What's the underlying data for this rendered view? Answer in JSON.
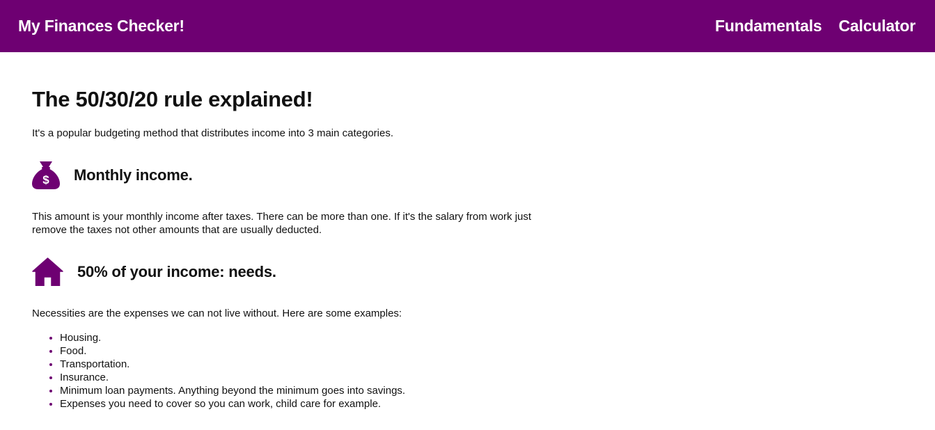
{
  "navbar": {
    "brand": "My Finances Checker!",
    "links": [
      {
        "label": "Fundamentals"
      },
      {
        "label": "Calculator"
      }
    ]
  },
  "main": {
    "title": "The 50/30/20 rule explained!",
    "intro": "It's a popular budgeting method that distributes income into 3 main categories.",
    "sections": [
      {
        "icon": "money-bag-icon",
        "heading": "Monthly income.",
        "text": "This amount is your monthly income after taxes. There can be more than one. If it's the salary from work just remove the taxes not other amounts that are usually deducted."
      },
      {
        "icon": "house-icon",
        "heading": "50% of your income: needs.",
        "text": "Necessities are the expenses we can not live without. Here are some examples:",
        "list": [
          "Housing.",
          "Food.",
          "Transportation.",
          "Insurance.",
          "Minimum loan payments. Anything beyond the minimum goes into savings.",
          "Expenses you need to cover so you can work, child care for example."
        ]
      }
    ]
  },
  "colors": {
    "accent": "#6e0072",
    "text": "#111111",
    "background": "#ffffff"
  }
}
